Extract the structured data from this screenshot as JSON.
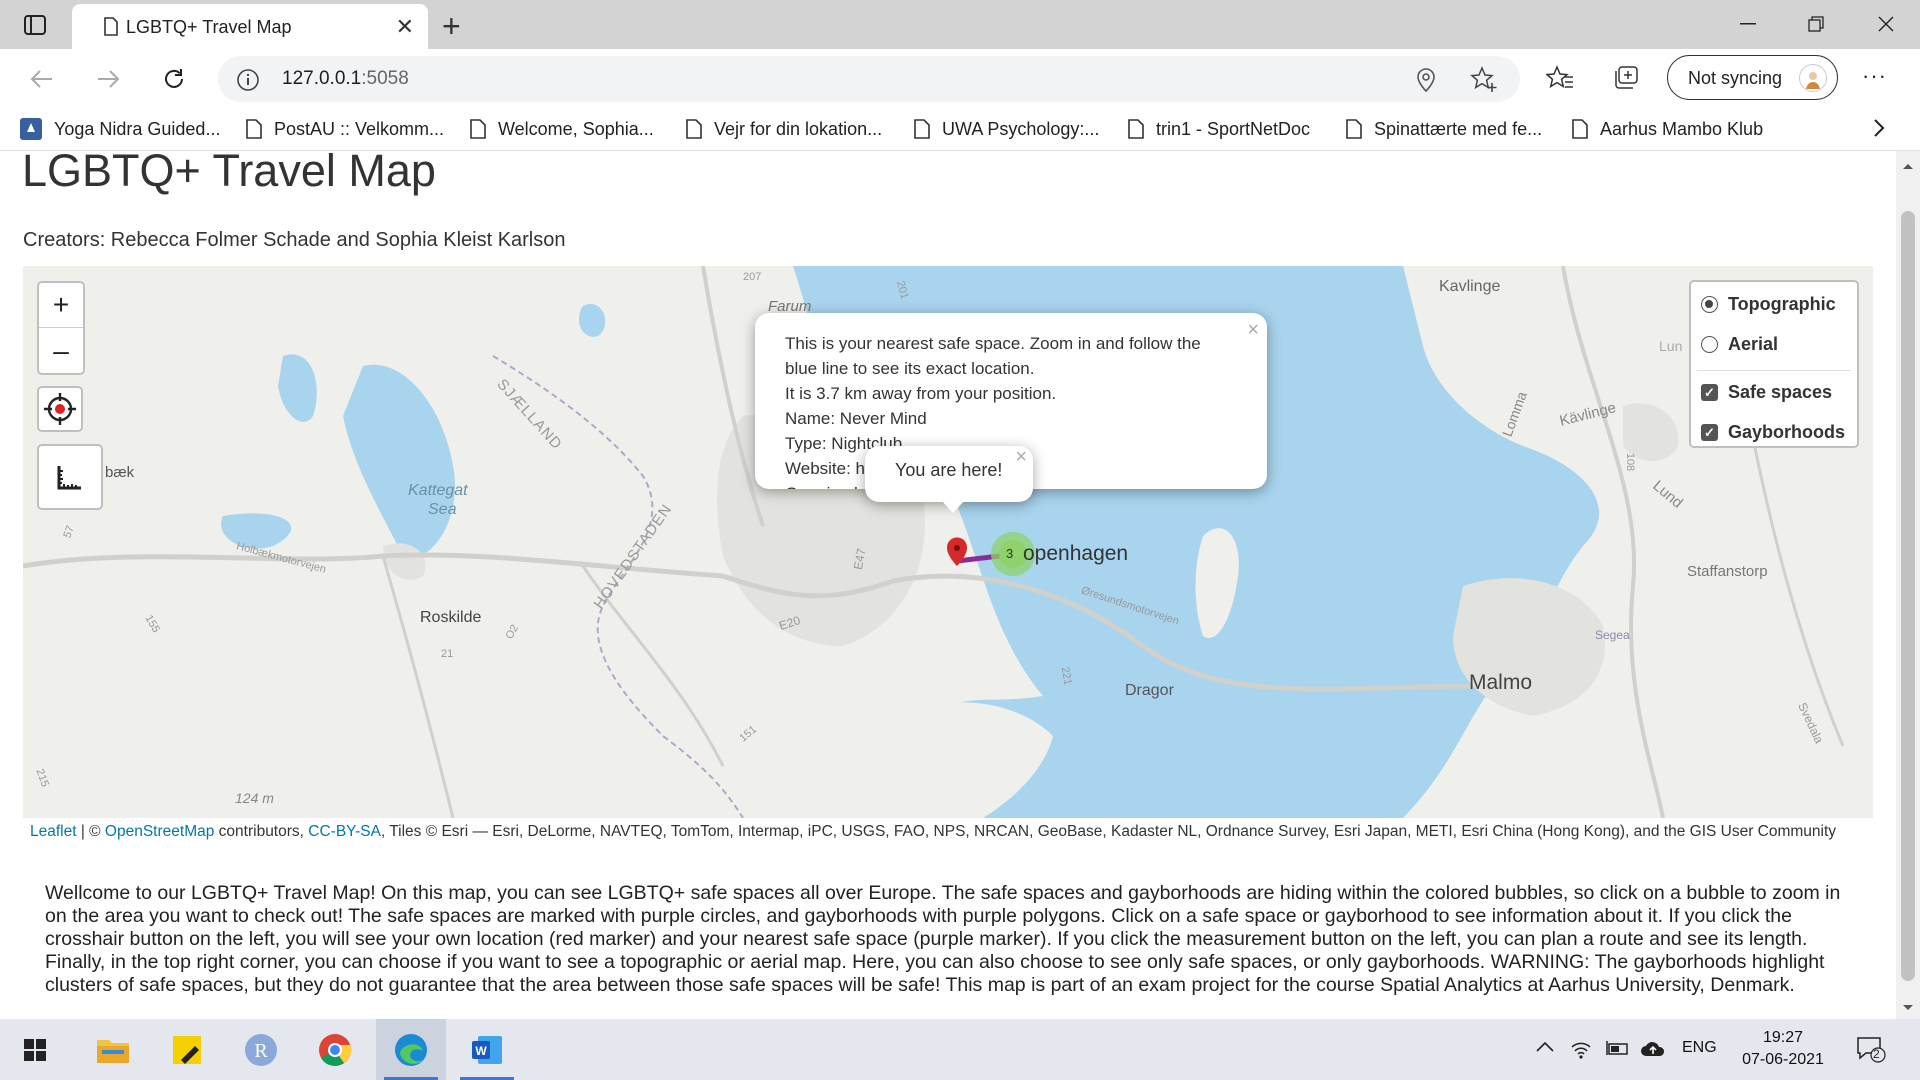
{
  "browser": {
    "tab_title": "LGBTQ+ Travel Map",
    "url_host": "127.0.0.1",
    "url_port": ":5058",
    "sync_label": "Not syncing"
  },
  "bookmarks": [
    {
      "label": "Yoga Nidra Guided...",
      "icon": "yoga-favicon"
    },
    {
      "label": "PostAU :: Velkomm...",
      "icon": "page-icon"
    },
    {
      "label": "Welcome, Sophia...",
      "icon": "page-icon"
    },
    {
      "label": "Vejr for din lokation...",
      "icon": "page-icon"
    },
    {
      "label": "UWA Psychology:...",
      "icon": "page-icon"
    },
    {
      "label": "trin1 - SportNetDoc",
      "icon": "page-icon"
    },
    {
      "label": "Spinattærte med fe...",
      "icon": "page-icon"
    },
    {
      "label": "Aarhus Mambo Klub",
      "icon": "page-icon"
    }
  ],
  "page": {
    "title": "LGBTQ+ Travel Map",
    "creators": "Creators: Rebecca Folmer Schade and Sophia Kleist Karlson",
    "intro": "Wellcome to our LGBTQ+ Travel Map! On this map, you can see LGBTQ+ safe spaces all over Europe. The safe spaces and gayborhoods are hiding within the colored bubbles, so click on a bubble to zoom in on the area you want to check out! The safe spaces are marked with purple circles, and gayborhoods with purple polygons. Click on a safe space or gayborhood to see information about it. If you click the crosshair button on the left, you will see your own location (red marker) and your nearest safe space (purple marker). If you click the measurement button on the left, you can plan a route and see its length. Finally, in the top right corner, you can choose if you want to see a topographic or aerial map. Here, you can also choose to see only safe spaces, or only gayborhoods. WARNING: The gayborhoods highlight clusters of safe spaces, but they do not guarantee that the area between those safe spaces will be safe! This map is part of an exam project for the course Spatial Analytics at Aarhus University, Denmark."
  },
  "map": {
    "zoom_in": "+",
    "zoom_out": "–",
    "layers": {
      "base": [
        {
          "label": "Topographic",
          "selected": true
        },
        {
          "label": "Aerial",
          "selected": false
        }
      ],
      "overlays": [
        {
          "label": "Safe spaces",
          "checked": true
        },
        {
          "label": "Gayborhoods",
          "checked": true
        }
      ]
    },
    "popup_safe": {
      "lines": [
        "This is your nearest safe space. Zoom in and follow the",
        "blue line to see its exact location.",
        "It is 3.7 km away from your position.",
        "Name: Never Mind",
        "Type: Nightclub",
        "Website: http://nevermindbar.dk/",
        "Opening h"
      ],
      "close": "×"
    },
    "popup_you": {
      "text": "You are here!",
      "close": "×"
    },
    "cluster_count": "3",
    "place_labels": {
      "copenhagen": "openhagen",
      "roskilde": "Roskilde",
      "kattegat": "Kattegat",
      "sea": "Sea",
      "malmo": "Malmo",
      "dragor": "Dragor",
      "kavlinge1": "Kavlinge",
      "kavlinge2": "Kävlinge",
      "farum": "Farum",
      "staffanstorp": "Staffanstorp",
      "lund": "Lund",
      "lomma": "Lomma",
      "sjaelland": "SJÆLLAND",
      "hovedstaden": "HOVEDSTADEN",
      "baek": "bæk",
      "holbaek": "Holbækmotorvejen",
      "oresund": "Øresundsmotorvejen",
      "e20": "E20",
      "e47": "E47",
      "elev": "124 m",
      "segea": "Segea",
      "svedala": "Svedala",
      "road155": "155",
      "road21": "21",
      "road151": "151",
      "road207": "207",
      "road221": "221",
      "road57": "57",
      "road215": "215",
      "road02": "O2",
      "road201": "201",
      "road108": "108",
      "lun": "Lun"
    },
    "attribution": {
      "leaflet": "Leaflet",
      "sep": " | © ",
      "osm": "OpenStreetMap",
      "contrib": " contributors, ",
      "ccbysa": "CC-BY-SA",
      "rest": ", Tiles © Esri — Esri, DeLorme, NAVTEQ, TomTom, Intermap, iPC, USGS, FAO, NPS, NRCAN, GeoBase, Kadaster NL, Ordnance Survey, Esri Japan, METI, Esri China (Hong Kong), and the GIS User Community"
    }
  },
  "taskbar": {
    "lang": "ENG",
    "time": "19:27",
    "date": "07-06-2021",
    "notifications": "2"
  },
  "colors": {
    "water": "#a8d4ee",
    "land": "#efefeb",
    "urban": "#e2e2de",
    "accent_link": "#0078a8",
    "cluster": "#8fd16a",
    "you_marker": "#d42a2a",
    "route": "#8a2c9c"
  }
}
